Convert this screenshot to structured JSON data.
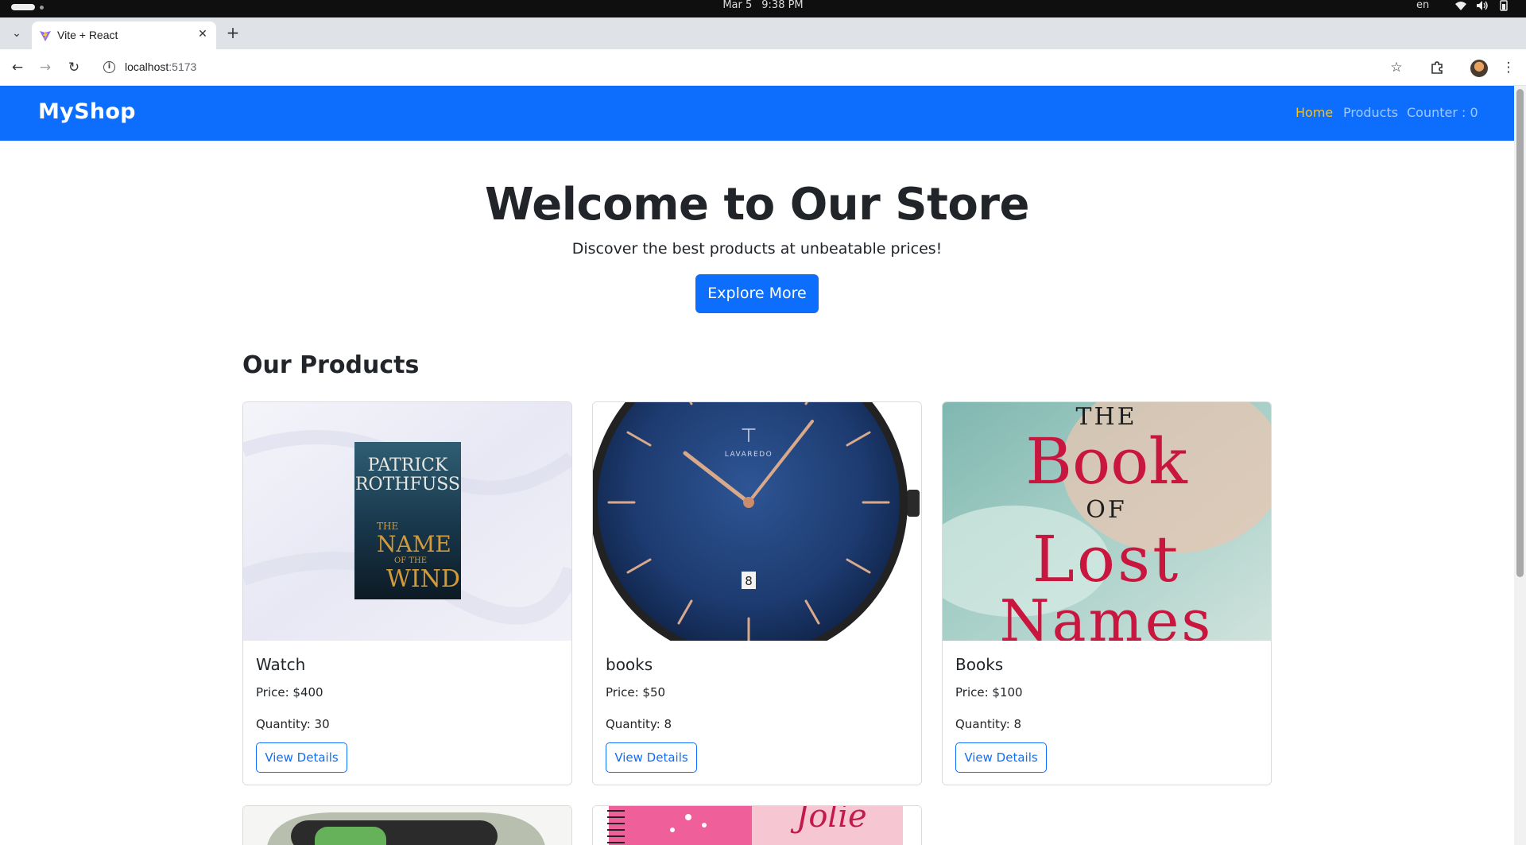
{
  "os": {
    "date": "Mar 5",
    "time": "9:38 PM",
    "language": "en",
    "icons": [
      "wifi-icon",
      "volume-icon",
      "battery-icon"
    ]
  },
  "browser": {
    "tab_title": "Vite + React",
    "url_host": "localhost",
    "url_port": ":5173"
  },
  "navbar": {
    "brand": "MyShop",
    "links": [
      {
        "label": "Home",
        "active": true
      },
      {
        "label": "Products",
        "active": false
      },
      {
        "label": "Counter : 0",
        "active": false
      }
    ],
    "color": "#0d6efd",
    "active_color": "#ffc107"
  },
  "hero": {
    "title": "Welcome to Our Store",
    "subtitle": "Discover the best products at unbeatable prices!",
    "button": "Explore More"
  },
  "products_section": {
    "title": "Our Products",
    "items": [
      {
        "name": "Watch",
        "price": "Price: $400",
        "quantity": "Quantity: 30",
        "button": "View Details",
        "image": "book-the-name-of-the-wind"
      },
      {
        "name": "books",
        "price": "Price: $50",
        "quantity": "Quantity: 8",
        "button": "View Details",
        "image": "blue-wristwatch"
      },
      {
        "name": "Books",
        "price": "Price: $100",
        "quantity": "Quantity: 8",
        "button": "View Details",
        "image": "book-the-book-of-lost-names"
      }
    ],
    "cover_text": {
      "author_line1": "PATRICK",
      "author_line2": "ROTHFUSS",
      "title_the": "THE",
      "title_name": "NAME",
      "title_of_the": "OF THE",
      "title_wind": "WIND",
      "watch_brand": "LAVAREDO",
      "watch_date": "8",
      "lost_the": "THE",
      "lost_book": "Book",
      "lost_of": "OF",
      "lost_lost": "Lost",
      "lost_names": "Names",
      "partial_script": "Jolie"
    }
  }
}
